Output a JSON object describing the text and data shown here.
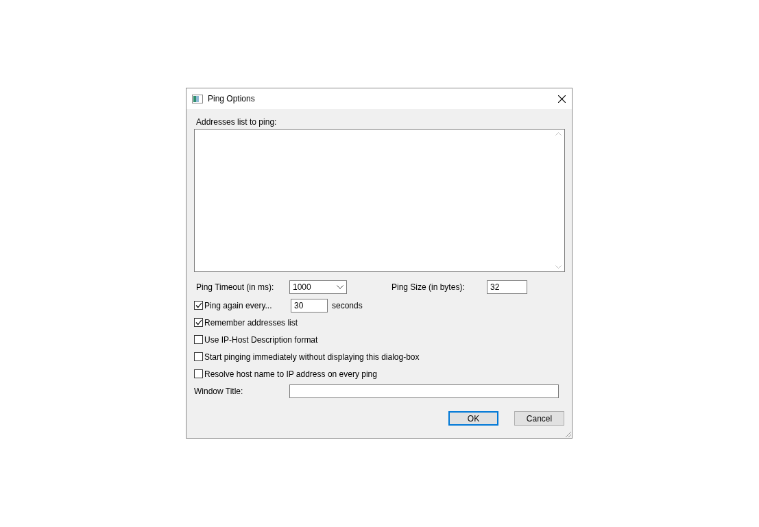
{
  "window": {
    "title": "Ping Options"
  },
  "addresses": {
    "label": "Addresses list to ping:"
  },
  "timeout": {
    "label": "Ping Timeout (in ms):",
    "value": "1000"
  },
  "size": {
    "label": "Ping Size (in bytes):",
    "value": "32"
  },
  "options": [
    {
      "kind": "interval",
      "label": "Ping again every...",
      "checked": true,
      "value": "30",
      "unit": "seconds"
    },
    {
      "kind": "plain",
      "label": "Remember addresses list",
      "checked": true
    },
    {
      "kind": "plain",
      "label": "Use IP-Host Description format",
      "checked": false
    },
    {
      "kind": "plain",
      "label": "Start pinging immediately without displaying this dialog-box",
      "checked": false
    },
    {
      "kind": "plain",
      "label": "Resolve host name to IP address on every ping",
      "checked": false
    }
  ],
  "window_title": {
    "label": "Window Title:"
  },
  "buttons": [
    {
      "label": "OK",
      "default": true
    },
    {
      "label": "Cancel",
      "default": false
    }
  ]
}
